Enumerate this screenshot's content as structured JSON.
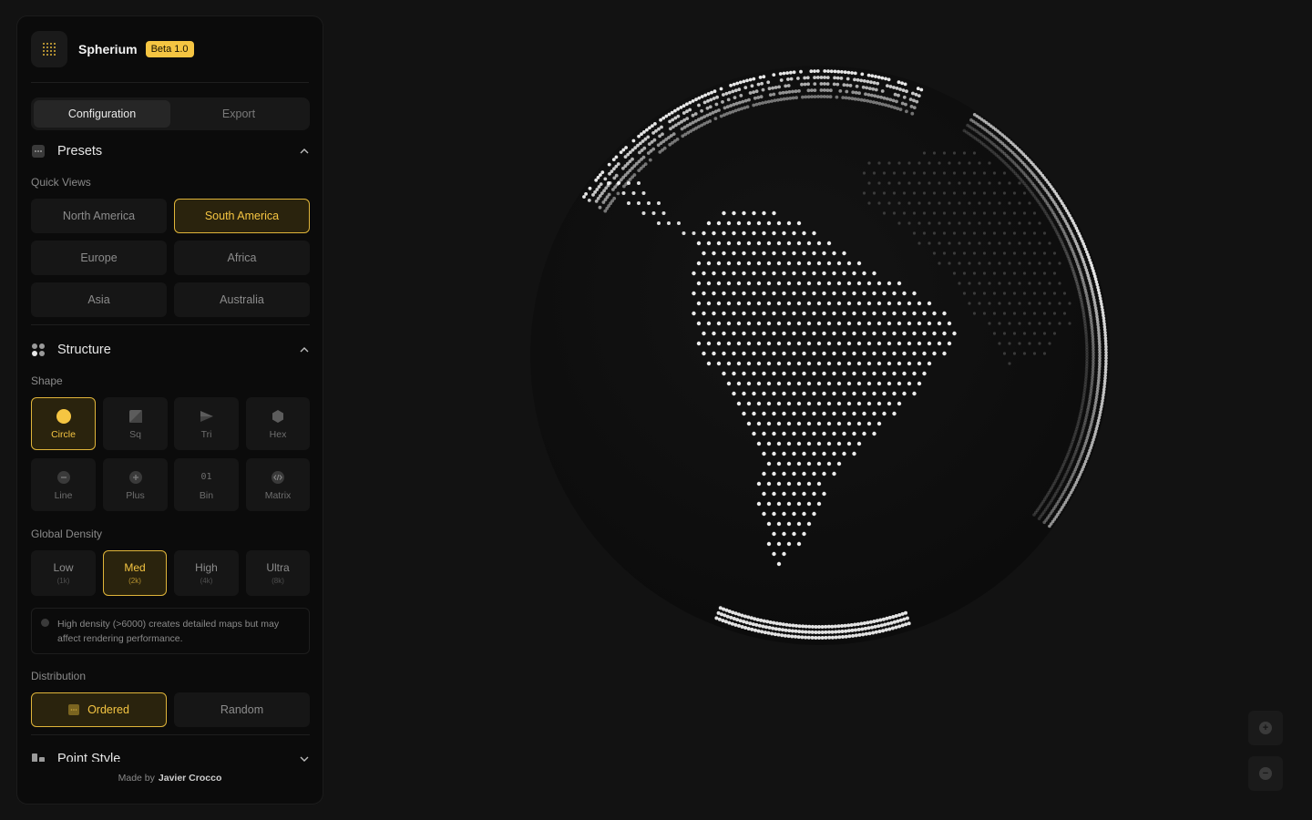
{
  "app": {
    "name": "Spherium",
    "badge": "Beta 1.0"
  },
  "tabs": [
    "Configuration",
    "Export"
  ],
  "presets": {
    "title": "Presets",
    "quick_views_label": "Quick Views",
    "items": [
      "North America",
      "South America",
      "Europe",
      "Africa",
      "Asia",
      "Australia"
    ],
    "selected": "South America"
  },
  "structure": {
    "title": "Structure",
    "shape_label": "Shape",
    "shapes": [
      "Circle",
      "Sq",
      "Tri",
      "Hex",
      "Line",
      "Plus",
      "Bin",
      "Matrix"
    ],
    "shape_glyph_bin": "01",
    "selected_shape": "Circle",
    "density_label": "Global Density",
    "densities": [
      {
        "label": "Low",
        "sub": "(1k)"
      },
      {
        "label": "Med",
        "sub": "(2k)"
      },
      {
        "label": "High",
        "sub": "(4k)"
      },
      {
        "label": "Ultra",
        "sub": "(8k)"
      }
    ],
    "selected_density": "Med",
    "density_note": "High density (>6000) creates detailed maps but may affect rendering performance.",
    "distribution_label": "Distribution",
    "distributions": [
      "Ordered",
      "Random"
    ],
    "selected_distribution": "Ordered"
  },
  "point_style": {
    "title": "Point Style"
  },
  "footer": {
    "prefix": "Made by",
    "author": "Javier Crocco"
  },
  "colors": {
    "accent": "#f5c542",
    "background": "#121212",
    "panel": "#0b0b0b"
  },
  "icons": {
    "zoom_in": "plus-icon",
    "zoom_out": "minus-icon"
  }
}
